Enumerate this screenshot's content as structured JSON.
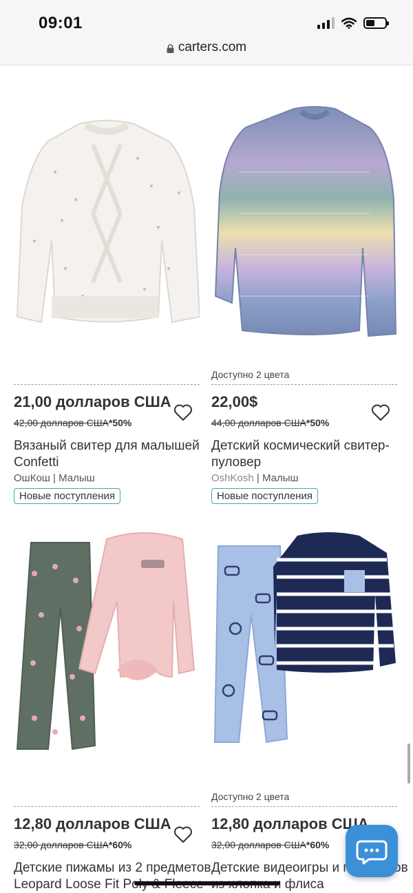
{
  "status_bar": {
    "time": "09:01"
  },
  "browser": {
    "url": "carters.com"
  },
  "products": [
    {
      "colors_available": "",
      "price": "21,00 долларов США",
      "old_price": "42,00 долларов США",
      "discount": "*50%",
      "name": "Вязаный свитер для малышей Confetti",
      "brand": "ОшКош",
      "category": "Малыш",
      "tag": "Новые поступления"
    },
    {
      "colors_available": "Доступно 2 цвета",
      "price": "22,00$",
      "old_price": "44,00 долларов США",
      "discount": "*50%",
      "name": "Детский космический свитер-пуловер",
      "brand": "OshKosh",
      "category": "Малыш",
      "tag": "Новые поступления"
    },
    {
      "colors_available": "",
      "price": "12,80 долларов США",
      "old_price": "32,00 долларов США",
      "discount": "*60%",
      "name": "Детские пижамы из 2 предметов Leopard Loose Fit Poly & Fleece"
    },
    {
      "colors_available": "Доступно 2 цвета",
      "price": "12,80 долларов США",
      "old_price": "32,00 долларов США",
      "discount": "*60%",
      "name": "Детские видеоигры и предметов из хлопка и флиса"
    }
  ]
}
